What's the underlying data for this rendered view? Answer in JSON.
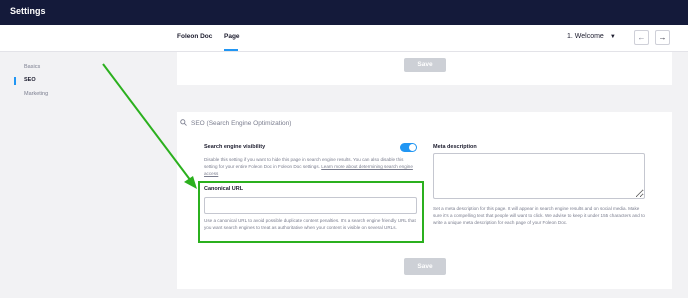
{
  "header": {
    "title": "Settings"
  },
  "tabs": [
    {
      "label": "Foleon Doc"
    },
    {
      "label": "Page"
    }
  ],
  "page_selector": {
    "value": "1. Welcome"
  },
  "sidebar": {
    "items": [
      {
        "label": "Basics"
      },
      {
        "label": "SEO"
      },
      {
        "label": "Marketing"
      }
    ]
  },
  "save_label": "Save",
  "seo": {
    "section_title": "SEO (Search Engine Optimization)",
    "visibility": {
      "label": "Search engine visibility",
      "help_text": "Disable this setting if you want to hide this page in search engine results. You can also disable this setting for your entire Foleon Doc in Foleon Doc settings.",
      "help_link": "Learn more about determining search engine access",
      "enabled": true
    },
    "canonical": {
      "label": "Canonical URL",
      "value": "",
      "help_text": "Use a canonical URL to avoid possible duplicate content penalties. It's a search engine friendly URL that you want search engines to treat as authoritative when your content is visible on several URLs."
    },
    "meta": {
      "label": "Meta description",
      "value": "",
      "help_text": "Set a meta description for this page. It will appear in search engine results and on social media. Make sure it's a compelling text that people will want to click. We advise to keep it under 155 characters and to write a unique meta description for each page of your Foleon Doc."
    }
  },
  "colors": {
    "accent": "#2196f3",
    "annotation": "#2bb01e",
    "topbar": "#141a3a"
  }
}
